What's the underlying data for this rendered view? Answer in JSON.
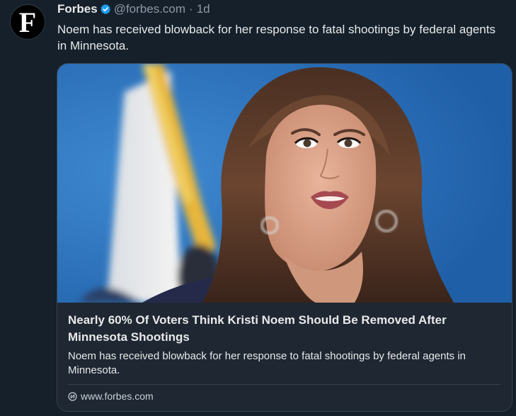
{
  "author": {
    "avatar_letter": "F",
    "name": "Forbes",
    "handle": "@forbes.com",
    "separator": "·",
    "time": "1d",
    "verified_icon": "verified-badge-icon"
  },
  "post": {
    "text": "Noem has received blowback for her response to fatal shootings by federal agents in Minnesota."
  },
  "card": {
    "title": "Nearly 60% Of Voters Think Kristi Noem Should Be Removed After Minnesota Shootings",
    "description": "Noem has received blowback for her response to fatal shootings by federal agents in Minnesota.",
    "domain": "www.forbes.com",
    "link_icon": "link-icon"
  },
  "colors": {
    "background": "#15202b",
    "card_body": "#1e2732",
    "border": "#38444d",
    "muted_text": "#8b98a5",
    "verified": "#1d9bf0"
  }
}
